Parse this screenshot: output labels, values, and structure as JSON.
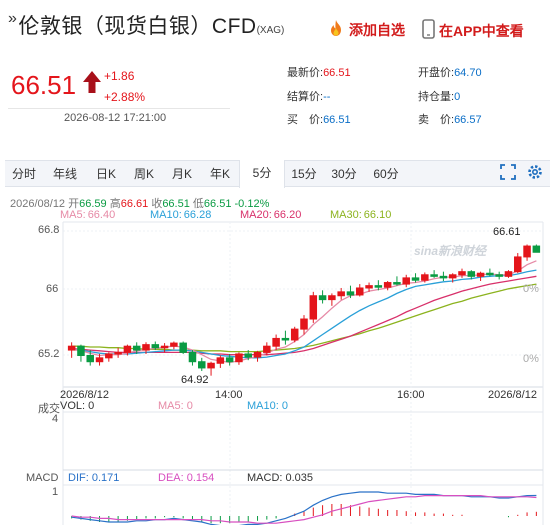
{
  "header": {
    "mark": "»",
    "title": "伦敦银（现货白银）CFD",
    "code": "(XAG)",
    "add_watchlist": "添加自选",
    "view_in_app": "在APP中查看"
  },
  "quote": {
    "price": "66.51",
    "change": "+1.86",
    "change_pct": "+2.88%",
    "time": "2026-08-12 17:21:00",
    "direction": "up"
  },
  "stats": [
    {
      "label": "最新价:",
      "value": "66.51",
      "style": "r"
    },
    {
      "label": "开盘价:",
      "value": "64.70",
      "style": "v"
    },
    {
      "label": "结算价:",
      "value": "--",
      "style": "v"
    },
    {
      "label": "持仓量:",
      "value": "0",
      "style": "v"
    },
    {
      "label": "买　价:",
      "value": "66.51",
      "style": "v"
    },
    {
      "label": "卖　价:",
      "value": "66.57",
      "style": "v"
    }
  ],
  "tabs": [
    "分时",
    "年线",
    "日K",
    "周K",
    "月K",
    "年K",
    "5分",
    "15分",
    "30分",
    "60分"
  ],
  "active_tab": "5分",
  "ohlc": {
    "date": "2026/08/12",
    "open_label": "开",
    "open": "66.59",
    "high_label": "高",
    "high": "66.61",
    "close_label": "收",
    "close": "66.51",
    "low_label": "低",
    "low": "66.51",
    "pct": "-0.12%"
  },
  "ma_legend": [
    {
      "label": "MA5:",
      "value": "66.40",
      "color": "#e68aa6"
    },
    {
      "label": "MA10:",
      "value": "66.28",
      "color": "#2aa0d8"
    },
    {
      "label": "MA20:",
      "value": "66.20",
      "color": "#d8306a"
    },
    {
      "label": "MA30:",
      "value": "66.10",
      "color": "#8cb31e"
    }
  ],
  "price_axis": {
    "top": "66.8",
    "mid": "66",
    "bottom": "65.2"
  },
  "pct_axis": {
    "mid": "0%",
    "bottom": "0%"
  },
  "time_axis": [
    "2026/8/12",
    "14:00",
    "16:00",
    "2026/8/12"
  ],
  "annotations": {
    "high": "66.61",
    "low": "64.92"
  },
  "watermark": "sina新浪财经",
  "volume": {
    "label": "成交",
    "vol": "VOL: 0",
    "ma5": "MA5: 0",
    "ma10": "MA10: 0",
    "axis_top": "4"
  },
  "macd": {
    "label": "MACD",
    "dif": "DIF: 0.171",
    "dea": "DEA: 0.154",
    "macd": "MACD: 0.035",
    "axis_top": "1"
  },
  "colors": {
    "up": "#e4151b",
    "down": "#0a9b43",
    "accent": "#0a6ec7",
    "ma5": "#e68aa6",
    "ma10": "#2aa0d8",
    "ma20": "#d8306a",
    "ma30": "#8cb31e"
  },
  "chart_data": {
    "type": "candlestick",
    "ylim": [
      64.8,
      66.9
    ],
    "candles": [
      [
        65.25,
        65.35,
        65.15,
        65.3
      ],
      [
        65.3,
        65.32,
        65.1,
        65.18
      ],
      [
        65.18,
        65.25,
        65.05,
        65.1
      ],
      [
        65.1,
        65.2,
        65.05,
        65.15
      ],
      [
        65.15,
        65.22,
        65.1,
        65.2
      ],
      [
        65.2,
        65.28,
        65.15,
        65.22
      ],
      [
        65.22,
        65.32,
        65.18,
        65.3
      ],
      [
        65.3,
        65.35,
        65.2,
        65.25
      ],
      [
        65.25,
        65.35,
        65.2,
        65.32
      ],
      [
        65.32,
        65.36,
        65.25,
        65.28
      ],
      [
        65.28,
        65.34,
        65.22,
        65.3
      ],
      [
        65.3,
        65.36,
        65.26,
        65.34
      ],
      [
        65.34,
        65.36,
        65.2,
        65.22
      ],
      [
        65.22,
        65.25,
        65.05,
        65.1
      ],
      [
        65.1,
        65.15,
        64.98,
        65.02
      ],
      [
        65.02,
        65.1,
        64.92,
        65.08
      ],
      [
        65.08,
        65.18,
        65.02,
        65.15
      ],
      [
        65.15,
        65.2,
        65.05,
        65.1
      ],
      [
        65.1,
        65.22,
        65.06,
        65.2
      ],
      [
        65.2,
        65.25,
        65.12,
        65.16
      ],
      [
        65.16,
        65.24,
        65.1,
        65.22
      ],
      [
        65.22,
        65.35,
        65.18,
        65.3
      ],
      [
        65.3,
        65.45,
        65.25,
        65.4
      ],
      [
        65.4,
        65.5,
        65.32,
        65.38
      ],
      [
        65.38,
        65.55,
        65.35,
        65.52
      ],
      [
        65.52,
        65.7,
        65.45,
        65.65
      ],
      [
        65.65,
        66.0,
        65.6,
        65.95
      ],
      [
        65.95,
        66.02,
        65.85,
        65.9
      ],
      [
        65.9,
        65.98,
        65.82,
        65.95
      ],
      [
        65.95,
        66.05,
        65.9,
        66.0
      ],
      [
        66.0,
        66.08,
        65.92,
        65.96
      ],
      [
        65.96,
        66.1,
        65.94,
        66.05
      ],
      [
        66.05,
        66.12,
        66.0,
        66.08
      ],
      [
        66.08,
        66.15,
        66.02,
        66.06
      ],
      [
        66.06,
        66.14,
        66.02,
        66.12
      ],
      [
        66.12,
        66.2,
        66.08,
        66.1
      ],
      [
        66.1,
        66.22,
        66.06,
        66.18
      ],
      [
        66.18,
        66.24,
        66.12,
        66.15
      ],
      [
        66.15,
        66.25,
        66.12,
        66.22
      ],
      [
        66.22,
        66.28,
        66.18,
        66.2
      ],
      [
        66.2,
        66.26,
        66.14,
        66.18
      ],
      [
        66.18,
        66.24,
        66.12,
        66.22
      ],
      [
        66.22,
        66.3,
        66.18,
        66.26
      ],
      [
        66.26,
        66.28,
        66.16,
        66.2
      ],
      [
        66.2,
        66.26,
        66.14,
        66.24
      ],
      [
        66.24,
        66.3,
        66.2,
        66.22
      ],
      [
        66.22,
        66.26,
        66.16,
        66.2
      ],
      [
        66.2,
        66.28,
        66.18,
        66.26
      ],
      [
        66.26,
        66.5,
        66.24,
        66.45
      ],
      [
        66.45,
        66.61,
        66.4,
        66.59
      ],
      [
        66.59,
        66.61,
        66.51,
        66.51
      ]
    ],
    "ma5": [
      65.26,
      65.24,
      65.21,
      65.18,
      65.19,
      65.19,
      65.21,
      65.24,
      65.26,
      65.27,
      65.29,
      65.3,
      65.29,
      65.25,
      65.19,
      65.13,
      65.11,
      65.09,
      65.11,
      65.14,
      65.17,
      65.21,
      65.26,
      65.29,
      65.36,
      65.45,
      65.58,
      65.68,
      65.79,
      65.89,
      65.95,
      65.97,
      66.01,
      66.03,
      66.05,
      66.08,
      66.11,
      66.12,
      66.14,
      66.17,
      66.19,
      66.19,
      66.21,
      66.21,
      66.22,
      66.23,
      66.22,
      66.22,
      66.27,
      66.35,
      66.4
    ],
    "ma10": [
      65.26,
      65.25,
      65.23,
      65.21,
      65.2,
      65.2,
      65.2,
      65.21,
      65.22,
      65.23,
      65.24,
      65.25,
      65.25,
      65.24,
      65.22,
      65.2,
      65.18,
      65.17,
      65.16,
      65.15,
      65.15,
      65.16,
      65.18,
      65.2,
      65.24,
      65.29,
      65.37,
      65.45,
      65.53,
      65.61,
      65.69,
      65.76,
      65.82,
      65.87,
      65.92,
      65.98,
      66.03,
      66.07,
      66.09,
      66.11,
      66.13,
      66.14,
      66.16,
      66.17,
      66.19,
      66.2,
      66.21,
      66.21,
      66.23,
      66.26,
      66.28
    ],
    "ma20": [
      65.27,
      65.26,
      65.25,
      65.24,
      65.23,
      65.22,
      65.22,
      65.22,
      65.22,
      65.22,
      65.22,
      65.22,
      65.22,
      65.22,
      65.21,
      65.2,
      65.2,
      65.19,
      65.19,
      65.19,
      65.19,
      65.19,
      65.2,
      65.21,
      65.22,
      65.24,
      65.27,
      65.31,
      65.35,
      65.39,
      65.43,
      65.48,
      65.53,
      65.58,
      65.63,
      65.68,
      65.74,
      65.79,
      65.84,
      65.89,
      65.93,
      65.97,
      66.01,
      66.04,
      66.07,
      66.1,
      66.12,
      66.14,
      66.16,
      66.18,
      66.2
    ],
    "ma30": [
      65.3,
      65.3,
      65.29,
      65.29,
      65.28,
      65.28,
      65.27,
      65.27,
      65.26,
      65.26,
      65.26,
      65.25,
      65.25,
      65.25,
      65.24,
      65.24,
      65.24,
      65.23,
      65.23,
      65.23,
      65.23,
      65.24,
      65.25,
      65.26,
      65.27,
      65.29,
      65.31,
      65.34,
      65.37,
      65.4,
      65.43,
      65.46,
      65.5,
      65.53,
      65.57,
      65.61,
      65.65,
      65.69,
      65.73,
      65.77,
      65.81,
      65.85,
      65.88,
      65.92,
      65.95,
      65.98,
      66.01,
      66.04,
      66.06,
      66.08,
      66.1
    ],
    "macd_hist": [
      -0.02,
      -0.03,
      -0.04,
      -0.05,
      -0.05,
      -0.05,
      -0.04,
      -0.03,
      -0.02,
      -0.02,
      -0.01,
      -0.01,
      -0.02,
      -0.03,
      -0.05,
      -0.06,
      -0.06,
      -0.06,
      -0.05,
      -0.05,
      -0.04,
      -0.03,
      -0.02,
      0.0,
      0.02,
      0.04,
      0.07,
      0.09,
      0.1,
      0.1,
      0.09,
      0.08,
      0.07,
      0.06,
      0.05,
      0.05,
      0.04,
      0.03,
      0.03,
      0.02,
      0.02,
      0.01,
      0.01,
      0.0,
      0.0,
      0.0,
      0.0,
      -0.01,
      0.01,
      0.03,
      0.035
    ],
    "dif": [
      -0.01,
      -0.02,
      -0.03,
      -0.04,
      -0.05,
      -0.05,
      -0.05,
      -0.04,
      -0.04,
      -0.03,
      -0.03,
      -0.02,
      -0.03,
      -0.04,
      -0.05,
      -0.07,
      -0.08,
      -0.08,
      -0.08,
      -0.07,
      -0.07,
      -0.06,
      -0.04,
      -0.02,
      0.01,
      0.04,
      0.09,
      0.13,
      0.16,
      0.18,
      0.19,
      0.2,
      0.2,
      0.2,
      0.19,
      0.19,
      0.19,
      0.18,
      0.18,
      0.18,
      0.17,
      0.17,
      0.17,
      0.16,
      0.16,
      0.16,
      0.15,
      0.15,
      0.16,
      0.17,
      0.171
    ],
    "dea": [
      0.0,
      -0.01,
      -0.01,
      -0.02,
      -0.02,
      -0.03,
      -0.03,
      -0.03,
      -0.03,
      -0.03,
      -0.03,
      -0.03,
      -0.03,
      -0.03,
      -0.03,
      -0.04,
      -0.04,
      -0.05,
      -0.05,
      -0.05,
      -0.06,
      -0.06,
      -0.06,
      -0.05,
      -0.04,
      -0.03,
      -0.01,
      0.01,
      0.04,
      0.06,
      0.08,
      0.1,
      0.12,
      0.13,
      0.14,
      0.15,
      0.16,
      0.16,
      0.17,
      0.17,
      0.17,
      0.17,
      0.17,
      0.17,
      0.17,
      0.16,
      0.16,
      0.16,
      0.16,
      0.16,
      0.154
    ]
  }
}
